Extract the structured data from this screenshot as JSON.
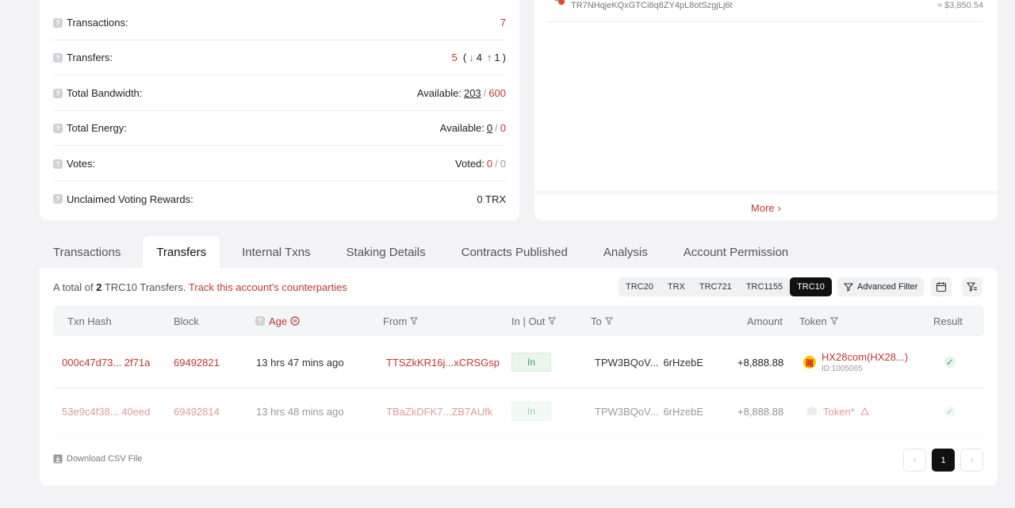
{
  "overview": {
    "rows": [
      {
        "label": "Transactions:",
        "value": "7"
      },
      {
        "label": "Transfers:",
        "value_count": "5",
        "open": "(",
        "in_count": "4",
        "out_count": "1",
        "close": ")"
      },
      {
        "label": "Total Bandwidth:",
        "prefix": "Available:",
        "available": "203",
        "sep": "/",
        "total": "600"
      },
      {
        "label": "Total Energy:",
        "prefix": "Available:",
        "available": "0",
        "sep": "/",
        "total": "0"
      },
      {
        "label": "Votes:",
        "prefix": "Voted:",
        "voted": "0",
        "sep": "/",
        "total": "0"
      },
      {
        "label": "Unclaimed Voting Rewards:",
        "value": "0 TRX"
      }
    ]
  },
  "holders": {
    "item_address": "TR7NHqjeKQxGTCi8q8ZY4pL8otSzgjLj6t",
    "item_usd": "≈ $3,850.54",
    "more_label": "More"
  },
  "tabs": [
    {
      "label": "Transactions",
      "active": false
    },
    {
      "label": "Transfers",
      "active": true
    },
    {
      "label": "Internal Txns",
      "active": false
    },
    {
      "label": "Staking Details",
      "active": false
    },
    {
      "label": "Contracts Published",
      "active": false
    },
    {
      "label": "Analysis",
      "active": false
    },
    {
      "label": "Account Permission",
      "active": false
    }
  ],
  "transfers": {
    "summary_prefix": "A total of",
    "summary_count": "2",
    "summary_suffix": "TRC10 Transfers.",
    "track_link": "Track this account's counterparties",
    "token_types": [
      "TRC20",
      "TRX",
      "TRC721",
      "TRC1155",
      "TRC10"
    ],
    "active_type": "TRC10",
    "advanced_filter": "Advanced Filter",
    "columns": {
      "hash": "Txn Hash",
      "block": "Block",
      "age": "Age",
      "from": "From",
      "inout": "In | Out",
      "to": "To",
      "amount": "Amount",
      "token": "Token",
      "result": "Result"
    },
    "rows": [
      {
        "hash": "000c47d73... 2f71a",
        "block": "69492821",
        "age": "13 hrs 47 mins ago",
        "from": "TTSZkKR16j...xCRSGsp",
        "inout": "In",
        "to_a": "TPW3BQoV...",
        "to_b": "6rHzebE",
        "amount": "+8,888.88",
        "token": "HX28com(HX28...)",
        "token_id": "ID:1005065",
        "token_icon": "賭"
      },
      {
        "hash": "53e9c4f38... 40eed",
        "block": "69492814",
        "age": "13 hrs 48 mins ago",
        "from": "TBaZkDFK7...ZB7AUfk",
        "inout": "In",
        "to_a": "TPW3BQoV...",
        "to_b": "6rHzebE",
        "amount": "+8,888.88",
        "token": "Token*",
        "token_id": ""
      }
    ],
    "csv_label": "Download CSV File",
    "current_page": "1"
  },
  "colors": {
    "accent": "#c23631",
    "green": "#3aa35a"
  }
}
